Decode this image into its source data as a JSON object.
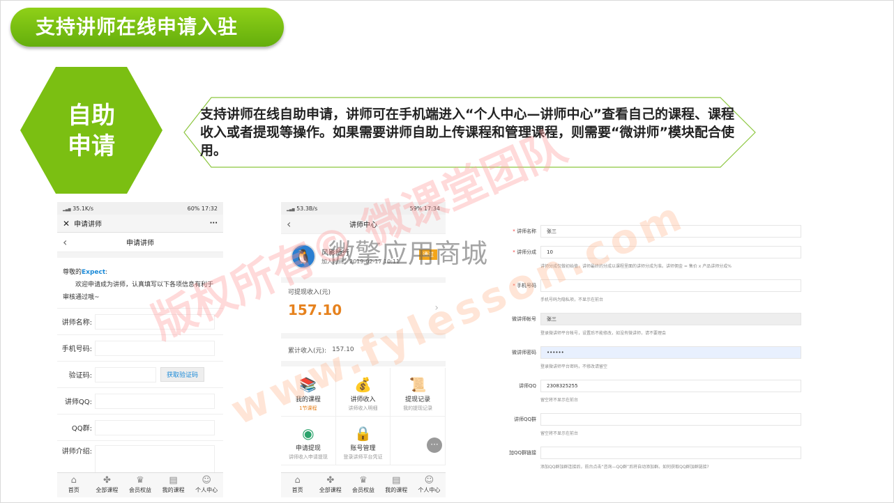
{
  "slide": {
    "title": "支持讲师在线申请入驻",
    "hex_line1": "自助",
    "hex_line2": "申请",
    "callout": "支持讲师在线自助申请，讲师可在手机端进入“个人中心—讲师中心”查看自己的课程、课程收入或者提现等操作。如果需要讲师自助上传课程和管理课程，则需要“微讲师”模块配合使用。"
  },
  "phone1": {
    "status_left": "35.1K/s",
    "status_right": "60% 17:32",
    "nav_title": "申请讲师",
    "nav_more": "···",
    "page_title": "申请讲师",
    "greeting_prefix": "尊敬的",
    "greeting_name": "Expect",
    "greeting_suffix": ":",
    "intro": "欢迎申请成为讲师，认真填写以下各项信息有利于审核通过哦~",
    "fields": {
      "name": "讲师名称:",
      "phone": "手机号码:",
      "code": "验证码:",
      "qq": "讲师QQ:",
      "qqgroup": "QQ群:",
      "intro": "讲师介绍:"
    },
    "get_code": "获取验证码"
  },
  "phone2": {
    "status_left": "53.3B/s",
    "status_right": "59% 17:34",
    "page_title": "讲师中心",
    "user_name": "风影随行",
    "join_time": "加入时间：2019-02-17 10:11",
    "badge": "通过",
    "withdrawable_label": "可提现收入(元)",
    "withdrawable_value": "157.10",
    "total_label": "累计收入(元):",
    "total_value": "157.10",
    "menu": [
      {
        "label": "我的课程",
        "sub": "1节课程"
      },
      {
        "label": "讲师收入",
        "sub": "讲师收入明细"
      },
      {
        "label": "提现记录",
        "sub": "我的提现记录"
      },
      {
        "label": "申请提现",
        "sub": "讲师收入申请提现"
      },
      {
        "label": "账号管理",
        "sub": "登录讲师平台凭证"
      }
    ]
  },
  "tabs": [
    "首页",
    "全部课程",
    "会员权益",
    "我的课程",
    "个人中心"
  ],
  "admin": {
    "rows": [
      {
        "label": "讲师名称",
        "required": true,
        "value": "张三",
        "hint": ""
      },
      {
        "label": "讲师分成",
        "required": true,
        "value": "10",
        "hint": "讲师分成仅做初始值，讲师最终的分成以课程里面的讲师分成为准。讲师佣金 = 售价 x 产品讲师分成%"
      },
      {
        "label": "手机号码",
        "required": true,
        "value": "",
        "hint": "手机号码为隐私项，不显示在前台"
      },
      {
        "label": "微讲师帐号",
        "required": false,
        "value": "张三",
        "hint": "登录微讲师平台帐号，设置后不能修改，如没有微讲师，请不要理会"
      },
      {
        "label": "微讲师密码",
        "required": false,
        "value": "••••••",
        "hint": "登录微讲师平台密码，不修改请留空"
      },
      {
        "label": "讲师QQ",
        "required": false,
        "value": "2308325255",
        "hint": "留空将不显示在前台"
      },
      {
        "label": "讲师QQ群",
        "required": false,
        "value": "",
        "hint": "留空将不显示在前台"
      },
      {
        "label": "加QQ群链接",
        "required": false,
        "value": "",
        "hint": "添加QQ群加群连接后，前台点击“咨询—QQ群”后将自动添加群。如何获取QQ群加群链接?"
      }
    ]
  },
  "watermarks": {
    "brand": "微擎应用商城",
    "copyright": "版权所有© 微课堂团队",
    "url": "www.fylesson.com"
  },
  "colors": {
    "accent_green": "#7bbf12",
    "link_blue": "#1a8ad8",
    "amount_orange": "#e6821e"
  }
}
